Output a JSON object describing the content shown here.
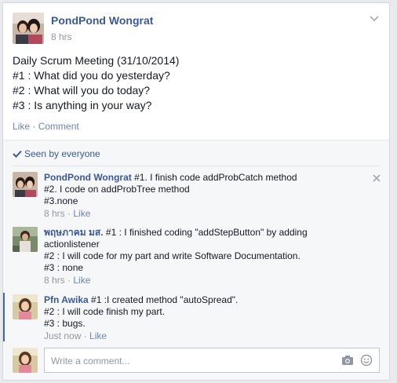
{
  "post": {
    "author": "PondPond Wongrat",
    "time": "8 hrs",
    "body_lines": [
      "Daily Scrum Meeting (31/10/2014)",
      "#1 : What did you do yesterday?",
      "#2 : What will you do today?",
      "#3 : Is anything in your way?"
    ],
    "actions": {
      "like": "Like",
      "separator": "·",
      "comment": "Comment"
    },
    "menu_icon": "chevron-down-icon"
  },
  "seen": {
    "label": "Seen by everyone",
    "icon": "checkmark-icon"
  },
  "comments": [
    {
      "author": "PondPond Wongrat",
      "lines": [
        "#1. I finish code addProbCatch method",
        "#2. I code on addProbTree method",
        "#3.none"
      ],
      "time": "8 hrs",
      "separator": "·",
      "like": "Like"
    },
    {
      "author": "พฤษภาคม มส.",
      "lines": [
        "#1 : I finished coding \"addStepButton\" by adding actionlistener",
        "#2 : I will code for my part and write Software Documentation.",
        "#3 : none"
      ],
      "time": "8 hrs",
      "separator": "·",
      "like": "Like"
    },
    {
      "author": "Pfn Awika",
      "lines": [
        "#1 :I created method \"autoSpread\".",
        "#2 : I will code finish my part.",
        "#3 : bugs."
      ],
      "time": "Just now",
      "separator": "·",
      "like": "Like"
    }
  ],
  "composer": {
    "placeholder": "Write a comment...",
    "camera_icon": "camera-icon",
    "emoji_icon": "smiley-icon"
  },
  "colors": {
    "link": "#3b5998",
    "meta": "#9197a3",
    "background": "#e9eaed",
    "ufi_background": "#f6f7f8"
  }
}
